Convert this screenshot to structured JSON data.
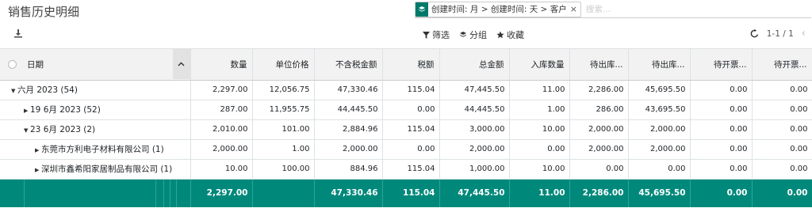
{
  "page": {
    "title": "销售历史明细"
  },
  "search": {
    "facet": "创建时间: 月 > 创建时间: 天 > 客户",
    "placeholder": "搜索..."
  },
  "toolbar": {
    "filter_label": "筛选",
    "group_label": "分组",
    "favorites_label": "收藏"
  },
  "pager": {
    "range": "1-1 / 1"
  },
  "columns": [
    "日期",
    "数量",
    "单位价格",
    "不含税金额",
    "税额",
    "总金额",
    "入库数量",
    "待出库...",
    "待出库...",
    "待开票...",
    "待开票..."
  ],
  "rows": [
    {
      "label": "六月 2023 (54)",
      "caret": "▼",
      "indent": 14,
      "values": [
        "2,297.00",
        "12,056.75",
        "47,330.46",
        "115.04",
        "47,445.50",
        "11.00",
        "2,286.00",
        "45,695.50",
        "0.00",
        "0.00"
      ]
    },
    {
      "label": "19 6月 2023 (52)",
      "caret": "▶",
      "indent": 30,
      "values": [
        "287.00",
        "11,955.75",
        "44,445.50",
        "0.00",
        "44,445.50",
        "1.00",
        "286.00",
        "43,695.50",
        "0.00",
        "0.00"
      ]
    },
    {
      "label": "23 6月 2023 (2)",
      "caret": "▼",
      "indent": 30,
      "values": [
        "2,010.00",
        "101.00",
        "2,884.96",
        "115.04",
        "3,000.00",
        "10.00",
        "2,000.00",
        "2,000.00",
        "0.00",
        "0.00"
      ]
    },
    {
      "label": "东莞市方利电子材料有限公司 (1)",
      "caret": "▶",
      "indent": 44,
      "values": [
        "2,000.00",
        "1.00",
        "2,000.00",
        "0.00",
        "2,000.00",
        "0.00",
        "2,000.00",
        "2,000.00",
        "0.00",
        "0.00"
      ]
    },
    {
      "label": "深圳市鑫希阳家居制品有限公司 (1)",
      "caret": "▶",
      "indent": 44,
      "values": [
        "10.00",
        "100.00",
        "884.96",
        "115.04",
        "1,000.00",
        "10.00",
        "0.00",
        "0.00",
        "0.00",
        "0.00"
      ]
    }
  ],
  "totals": [
    "2,297.00",
    "",
    "47,330.46",
    "115.04",
    "47,445.50",
    "11.00",
    "2,286.00",
    "45,695.50",
    "0.00",
    "0.00"
  ],
  "colors": {
    "accent": "#00897b",
    "facet_icon": "#00796b"
  }
}
